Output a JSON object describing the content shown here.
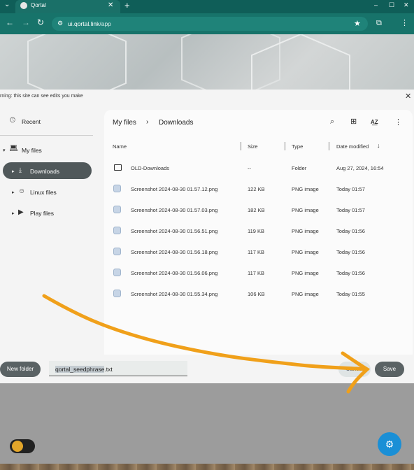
{
  "browser": {
    "tab_title": "Qortal",
    "url_host": "ui.qortal.link",
    "url_path": "/app",
    "new_tab": "+",
    "close_tab": "✕",
    "min": "–",
    "max": "☐",
    "close": "✕"
  },
  "dialog": {
    "warning": "rning: this site can see edits you make",
    "close": "✕",
    "sidebar": {
      "recent": "Recent",
      "my_files": "My files",
      "downloads": "Downloads",
      "linux_files": "Linux files",
      "play_files": "Play files"
    },
    "breadcrumb": {
      "root": "My files",
      "sep": "›",
      "current": "Downloads"
    },
    "columns": {
      "name": "Name",
      "size": "Size",
      "type": "Type",
      "date": "Date modified"
    },
    "files": [
      {
        "name": "OLD-Downloads",
        "size": "--",
        "type": "Folder",
        "date": "Aug 27, 2024, 16:54",
        "icon": "folder-icon"
      },
      {
        "name": "Screenshot 2024-08-30 01.57.12.png",
        "size": "122 KB",
        "type": "PNG image",
        "date": "Today 01:57",
        "icon": "image-file-icon"
      },
      {
        "name": "Screenshot 2024-08-30 01.57.03.png",
        "size": "182 KB",
        "type": "PNG image",
        "date": "Today 01:57",
        "icon": "image-file-icon"
      },
      {
        "name": "Screenshot 2024-08-30 01.56.51.png",
        "size": "119 KB",
        "type": "PNG image",
        "date": "Today 01:56",
        "icon": "image-file-icon"
      },
      {
        "name": "Screenshot 2024-08-30 01.56.18.png",
        "size": "117 KB",
        "type": "PNG image",
        "date": "Today 01:56",
        "icon": "image-file-icon"
      },
      {
        "name": "Screenshot 2024-08-30 01.56.06.png",
        "size": "117 KB",
        "type": "PNG image",
        "date": "Today 01:56",
        "icon": "image-file-icon"
      },
      {
        "name": "Screenshot 2024-08-30 01.55.34.png",
        "size": "106 KB",
        "type": "PNG image",
        "date": "Today 01:55",
        "icon": "image-file-icon"
      }
    ],
    "footer": {
      "new_folder": "New folder",
      "filename_value": "qortal_seedphrase",
      "filename_ext": ".txt",
      "cancel": "Cancel",
      "save": "Save"
    }
  },
  "colors": {
    "tabbar": "#0f5e58",
    "toolbar": "#17736a",
    "annotation": "#f0a01a",
    "fab": "#1a8fd6"
  }
}
